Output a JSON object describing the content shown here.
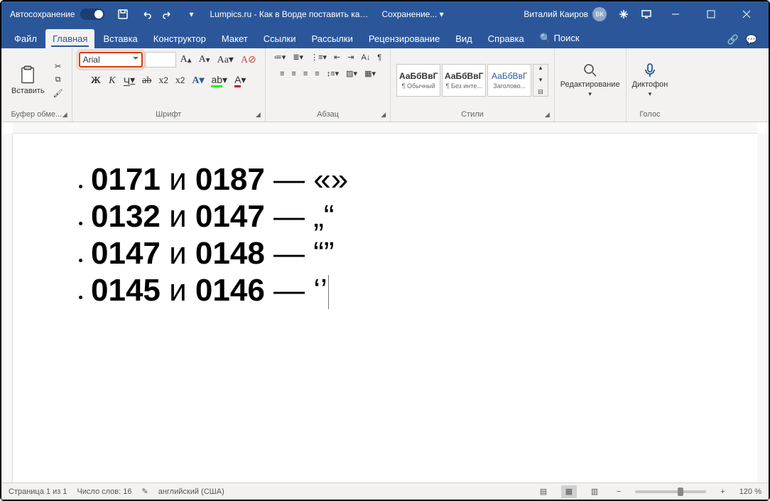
{
  "titlebar": {
    "autosave_label": "Автосохранение",
    "doc_title": "Lumpics.ru - Как в Ворде поставить ка... -",
    "saving_label": "Сохранение...",
    "user_name": "Виталий Каиров",
    "user_initials": "ВК"
  },
  "tabs": {
    "file": "Файл",
    "home": "Главная",
    "insert": "Вставка",
    "design": "Конструктор",
    "layout": "Макет",
    "references": "Ссылки",
    "mailings": "Рассылки",
    "review": "Рецензирование",
    "view": "Вид",
    "help": "Справка",
    "search": "Поиск"
  },
  "ribbon": {
    "clipboard": {
      "paste": "Вставить",
      "group_label": "Буфер обме..."
    },
    "font": {
      "name": "Arial",
      "size": "",
      "group_label": "Шрифт",
      "bold": "Ж",
      "italic": "К",
      "underline": "Ч"
    },
    "para": {
      "group_label": "Абзац"
    },
    "styles": {
      "group_label": "Стили",
      "sample": "АаБбВвГ",
      "normal": "¶ Обычный",
      "nospace": "¶ Без инте...",
      "heading": "Заголово..."
    },
    "editing": {
      "group_label": "Редактирование"
    },
    "voice": {
      "label": "Диктофон",
      "group_label": "Голос"
    }
  },
  "document": {
    "rows": [
      {
        "c1": "0171",
        "mid": " и ",
        "c2": "0187",
        "dash": " — ",
        "sym": "«»"
      },
      {
        "c1": "0132",
        "mid": " и ",
        "c2": "0147",
        "dash": " — ",
        "sym": "„“"
      },
      {
        "c1": "0147",
        "mid": " и ",
        "c2": "0148",
        "dash": " — ",
        "sym": "“”"
      },
      {
        "c1": "0145",
        "mid": " и ",
        "c2": "0146",
        "dash": " — ",
        "sym": "‘’"
      }
    ]
  },
  "status": {
    "page": "Страница 1 из 1",
    "words": "Число слов: 16",
    "lang": "английский (США)",
    "zoom": "120 %"
  }
}
